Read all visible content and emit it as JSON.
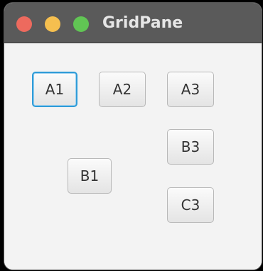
{
  "window": {
    "title": "GridPane"
  },
  "traffic_lights": {
    "close_color": "#ed6a5e",
    "minimize_color": "#f5bf4f",
    "zoom_color": "#61c554"
  },
  "grid": {
    "buttons": {
      "a1": "A1",
      "a2": "A2",
      "a3": "A3",
      "b1": "B1",
      "b3": "B3",
      "c3": "C3"
    },
    "focused": "A1",
    "focus_color": "#2f9cd8"
  }
}
